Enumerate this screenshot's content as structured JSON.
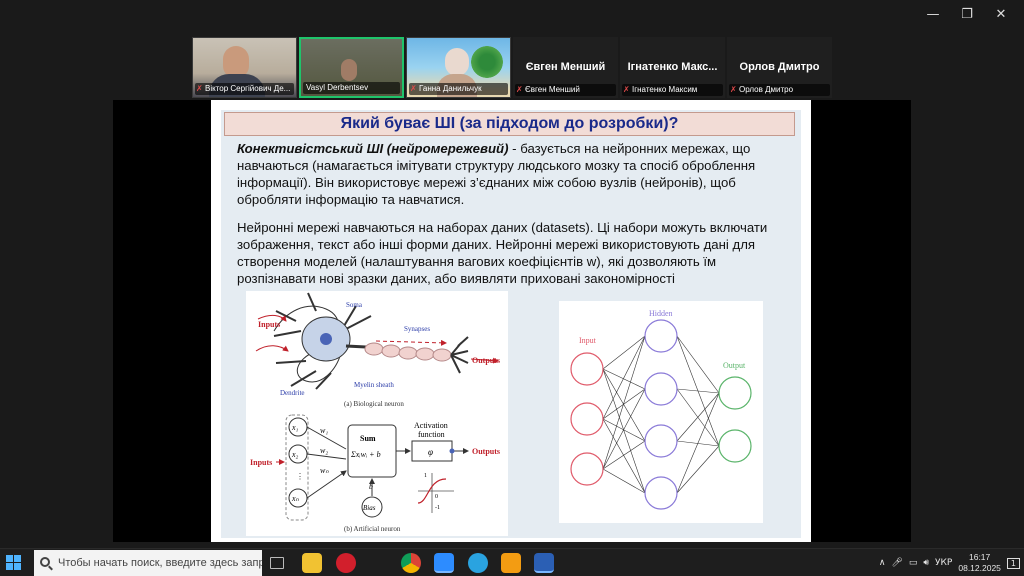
{
  "window": {
    "minimize": "—",
    "restore": "❐",
    "close": "✕"
  },
  "participants": [
    {
      "name": "Віктор Сергійович Де...",
      "video": true
    },
    {
      "name": "Vasyl Derbentsev",
      "video": true
    },
    {
      "name": "Ганна Данильчук",
      "video": true
    },
    {
      "name": "Євген Менший",
      "display": "Євген Менший",
      "video": false
    },
    {
      "name": "Ігнатенко Максим",
      "display": "Ігнатенко Макс...",
      "video": false
    },
    {
      "name": "Орлов Дмитро",
      "display": "Орлов Дмитро",
      "video": false
    }
  ],
  "slide": {
    "title": "Який буває ШІ (за підходом до розробки)?",
    "p1_lead": "Конективістський ШІ (нейромережевий)",
    "p1_rest": " - базується на нейронних мережах, що навчаються (намагається імітувати структуру людського мозку  та спосіб оброблення інформації). Він використовує мережі з’єднаних між собою вузлів (нейронів), щоб обробляти інформацію та навчатися.",
    "p2": "Нейронні мережі навчаються на наборах даних (datasets). Ці набори можуть включати зображення, текст або інші форми даних. Нейронні мережі використовують дані для створення моделей (налаштування вагових коефіцієнтів  w), які дозволяють їм розпізнавати нові зразки даних, або виявляти приховані закономірності",
    "fig1": {
      "inputs": "Inputs",
      "soma": "Soma",
      "synapses": "Synapses",
      "outputs": "Outputs",
      "dendrite": "Dendrite",
      "myelin": "Myelin sheath",
      "caption_a": "(a) Biological neuron",
      "x1": "x₁",
      "x2": "x₂",
      "xn": "xₙ",
      "w1": "w₁",
      "w2": "w₂",
      "wn": "wₙ",
      "sum": "Sum",
      "sum_formula": "Σxᵢwᵢ + b",
      "activation1": "Activation",
      "activation2": "function",
      "phi": "φ",
      "b": "b",
      "bias": "Bias",
      "one": "1",
      "zero": "0",
      "minus_one": "-1",
      "caption_b": "(b) Artificial neuron"
    },
    "fig2": {
      "input": "Input",
      "hidden": "Hidden",
      "output": "Output"
    }
  },
  "taskbar": {
    "search_placeholder": "Чтобы начать поиск, введите здесь запрос",
    "lang": "УКР",
    "time": "16:17",
    "date": "08.12.2025",
    "notif_count": "1"
  },
  "colors": {
    "title_text": "#1a2a8a",
    "title_bg": "#f2dcd6",
    "active_speaker": "#1fc46b",
    "fig_red": "#c0202a",
    "fig_blue": "#2b3ca8",
    "nn_input": "#e05a6a",
    "nn_hidden": "#8a7ad8",
    "nn_output": "#5ab46a"
  }
}
